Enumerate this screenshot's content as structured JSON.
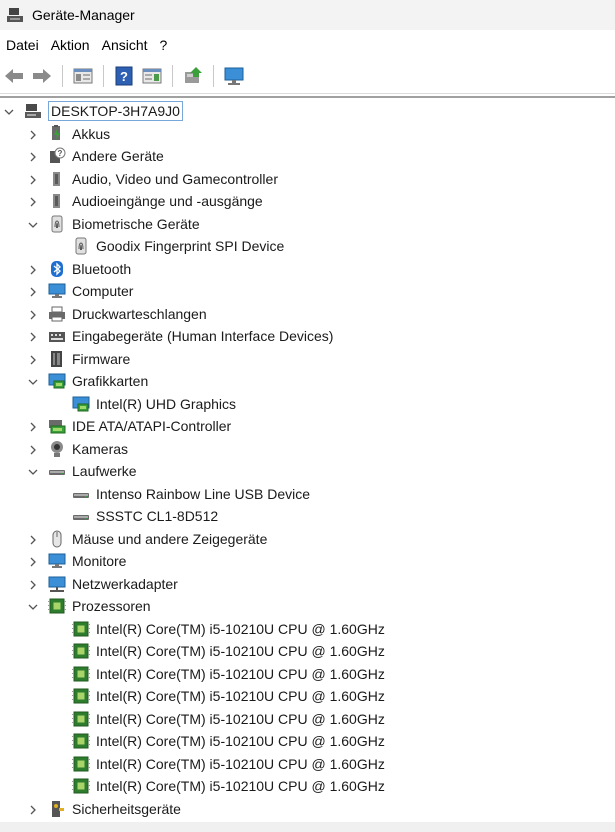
{
  "window": {
    "title": "Geräte-Manager"
  },
  "menu": [
    "Datei",
    "Aktion",
    "Ansicht",
    "?"
  ],
  "toolbar": [
    "back-icon",
    "forward-icon",
    "properties-icon",
    "help-icon",
    "view-icon",
    "update-driver-icon",
    "monitor-icon"
  ],
  "tree": {
    "root": "DESKTOP-3H7A9J0",
    "items": [
      {
        "label": "Akkus",
        "icon": "battery-icon",
        "expanded": false
      },
      {
        "label": "Andere Geräte",
        "icon": "unknown-device-icon",
        "expanded": false
      },
      {
        "label": "Audio, Video und Gamecontroller",
        "icon": "speaker-icon",
        "expanded": false
      },
      {
        "label": "Audioeingänge und -ausgänge",
        "icon": "speaker-icon",
        "expanded": false
      },
      {
        "label": "Biometrische Geräte",
        "icon": "fingerprint-icon",
        "expanded": true,
        "children": [
          {
            "label": "Goodix Fingerprint SPI Device",
            "icon": "fingerprint-icon"
          }
        ]
      },
      {
        "label": "Bluetooth",
        "icon": "bluetooth-icon",
        "expanded": false
      },
      {
        "label": "Computer",
        "icon": "computer-icon",
        "expanded": false
      },
      {
        "label": "Druckwarteschlangen",
        "icon": "printer-icon",
        "expanded": false
      },
      {
        "label": "Eingabegeräte (Human Interface Devices)",
        "icon": "hid-icon",
        "expanded": false
      },
      {
        "label": "Firmware",
        "icon": "firmware-icon",
        "expanded": false
      },
      {
        "label": "Grafikkarten",
        "icon": "display-adapter-icon",
        "expanded": true,
        "children": [
          {
            "label": "Intel(R) UHD Graphics",
            "icon": "display-adapter-icon"
          }
        ]
      },
      {
        "label": "IDE ATA/ATAPI-Controller",
        "icon": "ide-icon",
        "expanded": false
      },
      {
        "label": "Kameras",
        "icon": "camera-icon",
        "expanded": false
      },
      {
        "label": "Laufwerke",
        "icon": "drive-icon",
        "expanded": true,
        "children": [
          {
            "label": "Intenso Rainbow Line USB Device",
            "icon": "drive-icon"
          },
          {
            "label": "SSSTC CL1-8D512",
            "icon": "drive-icon"
          }
        ]
      },
      {
        "label": "Mäuse und andere Zeigegeräte",
        "icon": "mouse-icon",
        "expanded": false
      },
      {
        "label": "Monitore",
        "icon": "monitor-icon",
        "expanded": false
      },
      {
        "label": "Netzwerkadapter",
        "icon": "network-icon",
        "expanded": false
      },
      {
        "label": "Prozessoren",
        "icon": "cpu-icon",
        "expanded": true,
        "children": [
          {
            "label": "Intel(R) Core(TM) i5-10210U CPU @ 1.60GHz",
            "icon": "cpu-icon"
          },
          {
            "label": "Intel(R) Core(TM) i5-10210U CPU @ 1.60GHz",
            "icon": "cpu-icon"
          },
          {
            "label": "Intel(R) Core(TM) i5-10210U CPU @ 1.60GHz",
            "icon": "cpu-icon"
          },
          {
            "label": "Intel(R) Core(TM) i5-10210U CPU @ 1.60GHz",
            "icon": "cpu-icon"
          },
          {
            "label": "Intel(R) Core(TM) i5-10210U CPU @ 1.60GHz",
            "icon": "cpu-icon"
          },
          {
            "label": "Intel(R) Core(TM) i5-10210U CPU @ 1.60GHz",
            "icon": "cpu-icon"
          },
          {
            "label": "Intel(R) Core(TM) i5-10210U CPU @ 1.60GHz",
            "icon": "cpu-icon"
          },
          {
            "label": "Intel(R) Core(TM) i5-10210U CPU @ 1.60GHz",
            "icon": "cpu-icon"
          }
        ]
      },
      {
        "label": "Sicherheitsgeräte",
        "icon": "security-icon",
        "expanded": false
      }
    ]
  }
}
